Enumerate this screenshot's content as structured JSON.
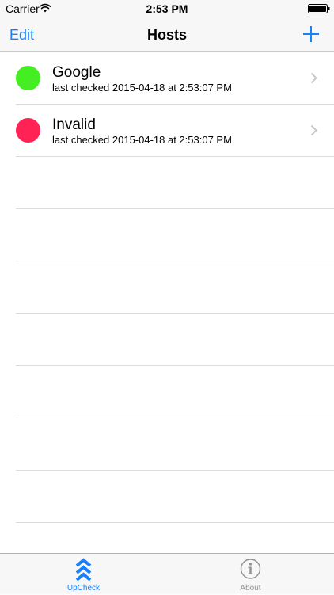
{
  "status_bar": {
    "carrier": "Carrier",
    "time": "2:53 PM",
    "wifi_icon": "wifi-icon",
    "battery_icon": "battery-icon"
  },
  "nav": {
    "edit_label": "Edit",
    "title": "Hosts",
    "add_icon": "plus-icon"
  },
  "hosts": [
    {
      "name": "Google",
      "last_checked": "last checked 2015-04-18 at 2:53:07 PM",
      "status": "up",
      "status_color": "#44ee22"
    },
    {
      "name": "Invalid",
      "last_checked": "last checked 2015-04-18 at 2:53:07 PM",
      "status": "down",
      "status_color": "#ff2255"
    }
  ],
  "tabs": [
    {
      "label": "UpCheck",
      "icon": "triple-chevron-up-icon",
      "selected": true
    },
    {
      "label": "About",
      "icon": "info-icon",
      "selected": false
    }
  ],
  "colors": {
    "accent": "#1a7ffb",
    "inactive": "#929292",
    "separator": "#dcdce0",
    "bar_background": "#f7f7f8"
  }
}
